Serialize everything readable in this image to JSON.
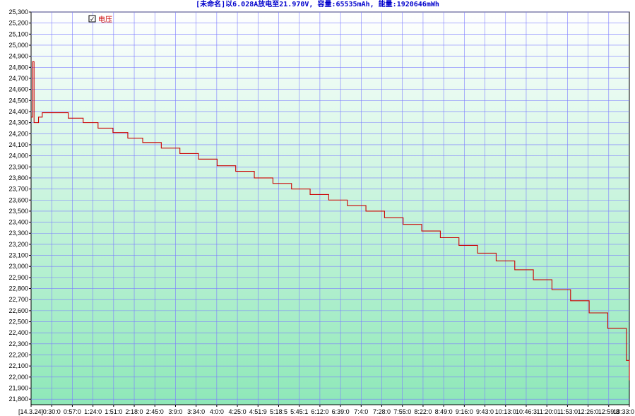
{
  "chart_data": {
    "type": "line",
    "title": "[未命名]以6.028A放电至21.970V, 容量:65535mAh, 能量:1920646mWh",
    "xlabel": "",
    "ylabel": "",
    "ylim": [
      21750,
      25300
    ],
    "y_ticks": [
      21800,
      21900,
      22000,
      22100,
      22200,
      22300,
      22400,
      22500,
      22600,
      22700,
      22800,
      22900,
      23000,
      23100,
      23200,
      23300,
      23400,
      23500,
      23600,
      23700,
      23800,
      23900,
      24000,
      24100,
      24200,
      24300,
      24400,
      24500,
      24600,
      24700,
      24800,
      24900,
      25000,
      25100,
      25200,
      25300
    ],
    "y_tick_labels": [
      "21,800",
      "21,900",
      "22,000",
      "22,100",
      "22,200",
      "22,300",
      "22,400",
      "22,500",
      "22,600",
      "22,700",
      "22,800",
      "22,900",
      "23,000",
      "23,100",
      "23,200",
      "23,300",
      "23,400",
      "23,500",
      "23,600",
      "23,700",
      "23,800",
      "23,900",
      "24,000",
      "24,100",
      "24,200",
      "24,300",
      "24,400",
      "24,500",
      "24,600",
      "24,700",
      "24,800",
      "24,900",
      "25,000",
      "25,100",
      "25,200",
      "25,300"
    ],
    "x_tick_labels": [
      "[14.3.24]",
      "0:30:0",
      "0:57:0",
      "1:24:0",
      "1:51:0",
      "2:18:0",
      "2:45:0",
      "3:9:0",
      "3:34:0",
      "4:0:0",
      "4:25:0",
      "4:51:9",
      "5:18:5",
      "5:45:1",
      "6:12:0",
      "6:39:0",
      "7:4:0",
      "7:28:0",
      "7:55:0",
      "8:22:0",
      "8:49:0",
      "9:16:0",
      "9:43:0",
      "10:13:0",
      "10:46:3",
      "11:20:0",
      "11:53:0",
      "12:26:0",
      "12:59:8",
      "13:33:0"
    ],
    "xlim": [
      0,
      804
    ],
    "grid": true,
    "legend": "top-left",
    "series": [
      {
        "name": "电压",
        "color": "#cc0000",
        "x": [
          0,
          2,
          4,
          6,
          10,
          15,
          20,
          30,
          50,
          70,
          90,
          110,
          130,
          150,
          175,
          200,
          225,
          250,
          275,
          300,
          325,
          350,
          375,
          400,
          425,
          450,
          475,
          500,
          525,
          550,
          575,
          600,
          625,
          650,
          675,
          700,
          725,
          750,
          775,
          800,
          804
        ],
        "y": [
          24350,
          24850,
          24300,
          24300,
          24350,
          24390,
          24390,
          24390,
          24340,
          24300,
          24250,
          24210,
          24160,
          24120,
          24070,
          24020,
          23970,
          23910,
          23860,
          23800,
          23750,
          23700,
          23650,
          23600,
          23550,
          23500,
          23440,
          23380,
          23320,
          23260,
          23190,
          23120,
          23050,
          22970,
          22880,
          22790,
          22690,
          22580,
          22440,
          22150,
          21970
        ]
      }
    ],
    "legend_checkbox": "☑",
    "background_top": "#ffffff",
    "background_bottom": "#8ee8b8",
    "grid_color": "#7d7dff"
  }
}
